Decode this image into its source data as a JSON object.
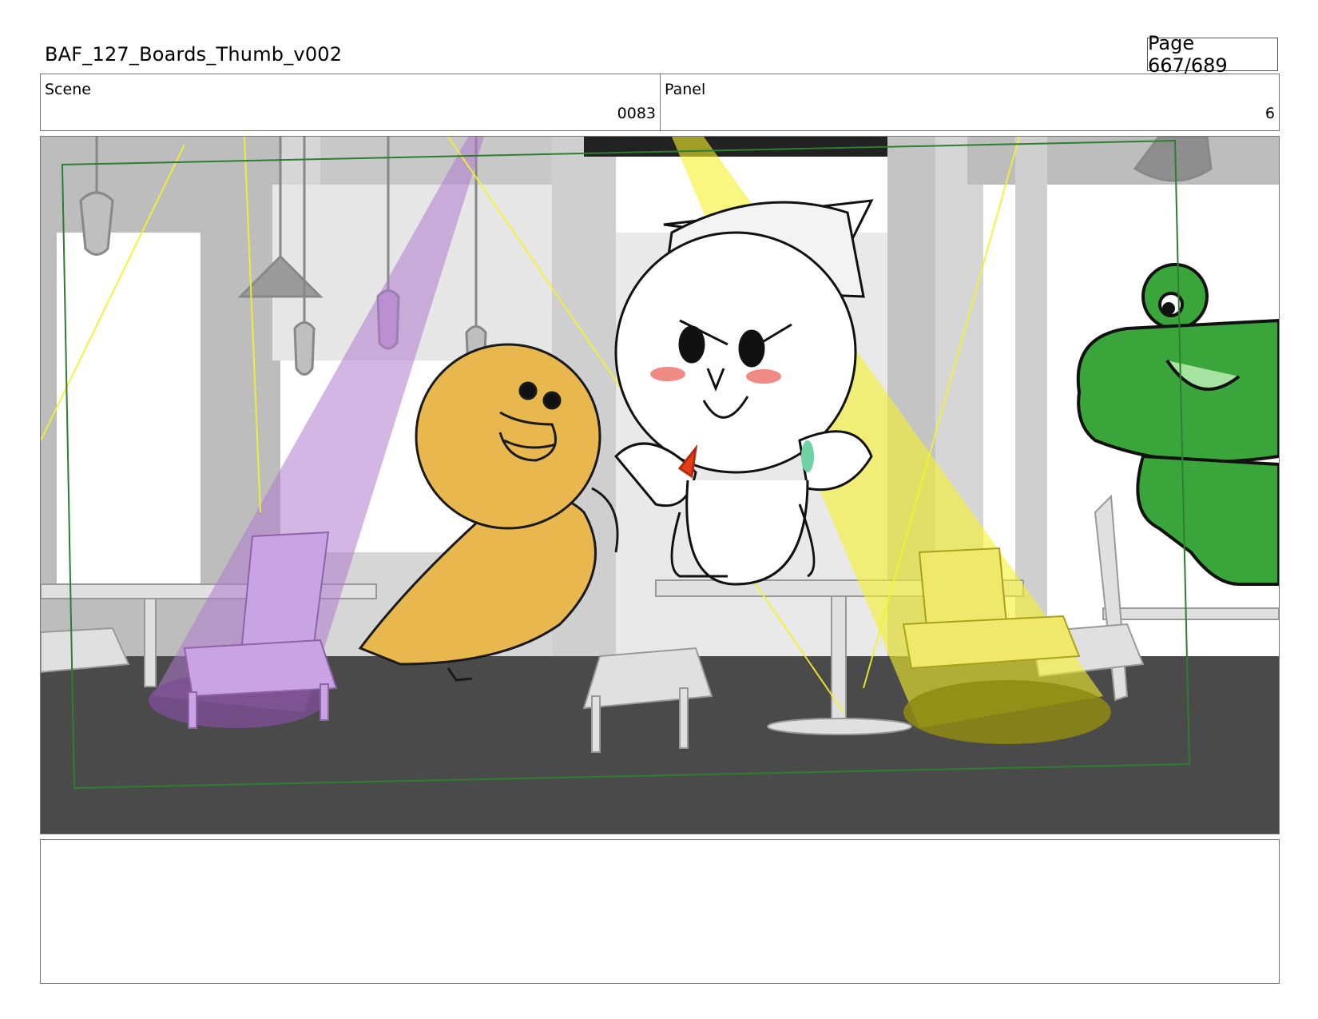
{
  "header": {
    "document_title": "BAF_127_Boards_Thumb_v002",
    "page_indicator": "Page 667/689"
  },
  "info": {
    "scene_label": "Scene",
    "scene_value": "0083",
    "panel_label": "Panel",
    "panel_value": "6"
  },
  "frame": {
    "colors": {
      "safe_frame": "#2e7d32",
      "purple_spotlight": "#b07ad0",
      "yellow_spotlight": "#f5f22a",
      "chick": "#e8b84e",
      "frog": "#3aa53a",
      "floor": "#4a4a4a",
      "blush": "#f08a84"
    },
    "elements": [
      "cafe-interior-background",
      "hanging-lamps",
      "tables-and-chairs",
      "purple-spotlight",
      "yellow-spotlight",
      "chick-character",
      "bear-character",
      "frog-character"
    ]
  },
  "notes": {
    "text": ""
  }
}
